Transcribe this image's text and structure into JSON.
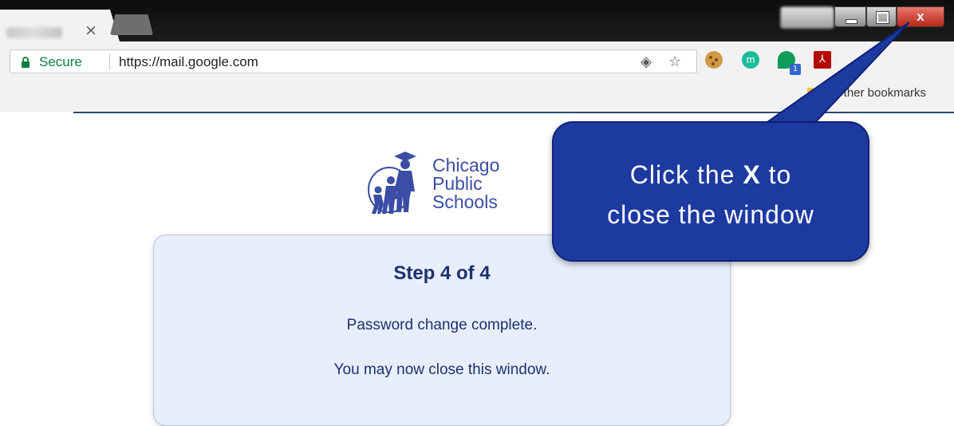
{
  "browser": {
    "tab_close_glyph": "×",
    "window_close_glyph": "x",
    "secure_label": "Secure",
    "url": "https://mail.google.com",
    "extension_m_label": "m",
    "extension_badge_count": "1",
    "bookmarks": {
      "other_bookmarks": "Other bookmarks"
    },
    "colors": {
      "secure_green": "#0b8043",
      "close_red": "#b9281a"
    },
    "icons": [
      "lock-icon",
      "eye-icon",
      "star-icon",
      "cookie-extension-icon",
      "m-extension-icon",
      "leaf-extension-icon",
      "pdf-extension-icon",
      "folder-icon"
    ]
  },
  "page": {
    "logo_lines": [
      "Chicago",
      "Public",
      "Schools"
    ],
    "step_title": "Step 4 of 4",
    "message_1": "Password change complete.",
    "message_2": "You may now close this window.",
    "colors": {
      "card_bg": "#e8eefb",
      "text": "#1c3170",
      "logo_blue": "#3b4da4"
    }
  },
  "callout": {
    "line1_prefix": "Click the ",
    "line1_bold": "X",
    "line1_suffix": " to",
    "line2": "close the window",
    "color": "#1d3aa1"
  }
}
